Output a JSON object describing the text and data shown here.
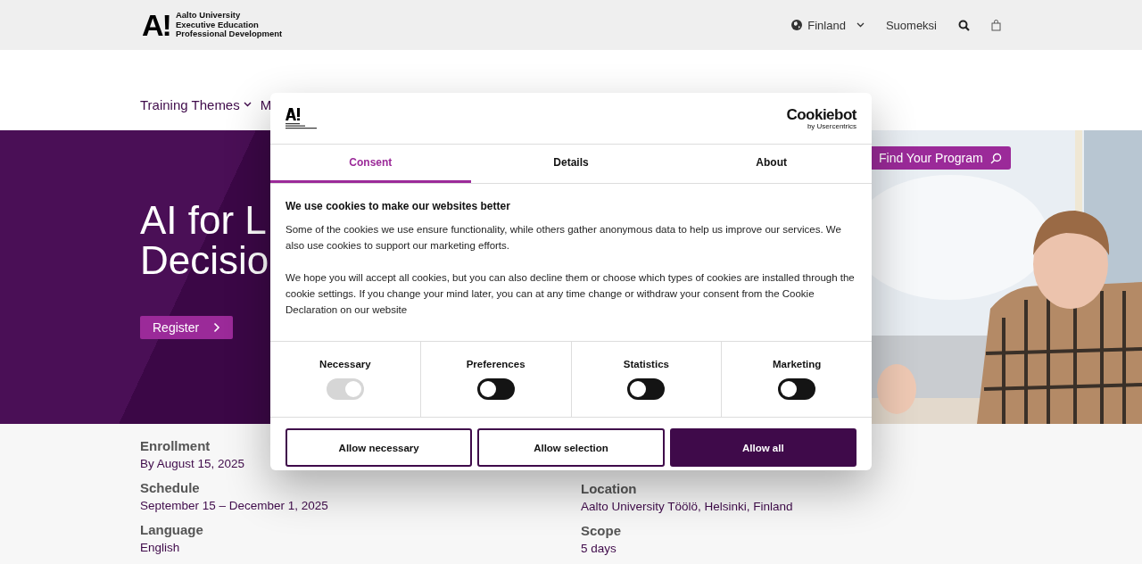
{
  "header": {
    "logo_mark": "A!",
    "logo_lines": [
      "Aalto University",
      "Executive Education",
      "Professional Development"
    ],
    "country": "Finland",
    "language": "Suomeksi"
  },
  "nav": {
    "items": [
      {
        "label": "Training Themes",
        "dropdown": true
      },
      {
        "label": "M"
      }
    ]
  },
  "hero": {
    "title_lines": [
      "AI for L",
      "Decisio"
    ],
    "register": "Register",
    "find_program": "Find Your Program",
    "image": {
      "kind": "picture"
    }
  },
  "details": {
    "left": [
      {
        "label": "Enrollment",
        "value": "By August 15, 2025"
      },
      {
        "label": "Schedule",
        "value": "September 15 – December 1, 2025"
      },
      {
        "label": "Language",
        "value": "English"
      }
    ],
    "right": [
      {
        "label": "Location",
        "value": "Aalto University Töölö, Helsinki, Finland"
      },
      {
        "label": "Scope",
        "value": "5 days"
      }
    ]
  },
  "consent": {
    "brand": "Cookiebot",
    "brand_sub": "by Usercentrics",
    "tabs": [
      {
        "label": "Consent",
        "selected": true
      },
      {
        "label": "Details",
        "selected": false
      },
      {
        "label": "About",
        "selected": false
      }
    ],
    "heading": "We use cookies to make our websites better",
    "paragraphs": [
      "Some of the cookies we use ensure functionality, while others gather anonymous data to help us improve our services. We also use cookies to support our marketing efforts.",
      "We hope you will accept all cookies, but you can also decline them or choose which types of cookies are installed through the cookie settings. If you change your mind later, you can at any time change or withdraw your consent from the Cookie Declaration on our website"
    ],
    "toggles": [
      {
        "label": "Necessary",
        "on": true,
        "disabled": true
      },
      {
        "label": "Preferences",
        "on": false,
        "disabled": false
      },
      {
        "label": "Statistics",
        "on": false,
        "disabled": false
      },
      {
        "label": "Marketing",
        "on": false,
        "disabled": false
      }
    ],
    "buttons": [
      {
        "label": "Allow necessary",
        "kind": "outline"
      },
      {
        "label": "Allow selection",
        "kind": "outline"
      },
      {
        "label": "Allow all",
        "kind": "primary"
      }
    ]
  }
}
